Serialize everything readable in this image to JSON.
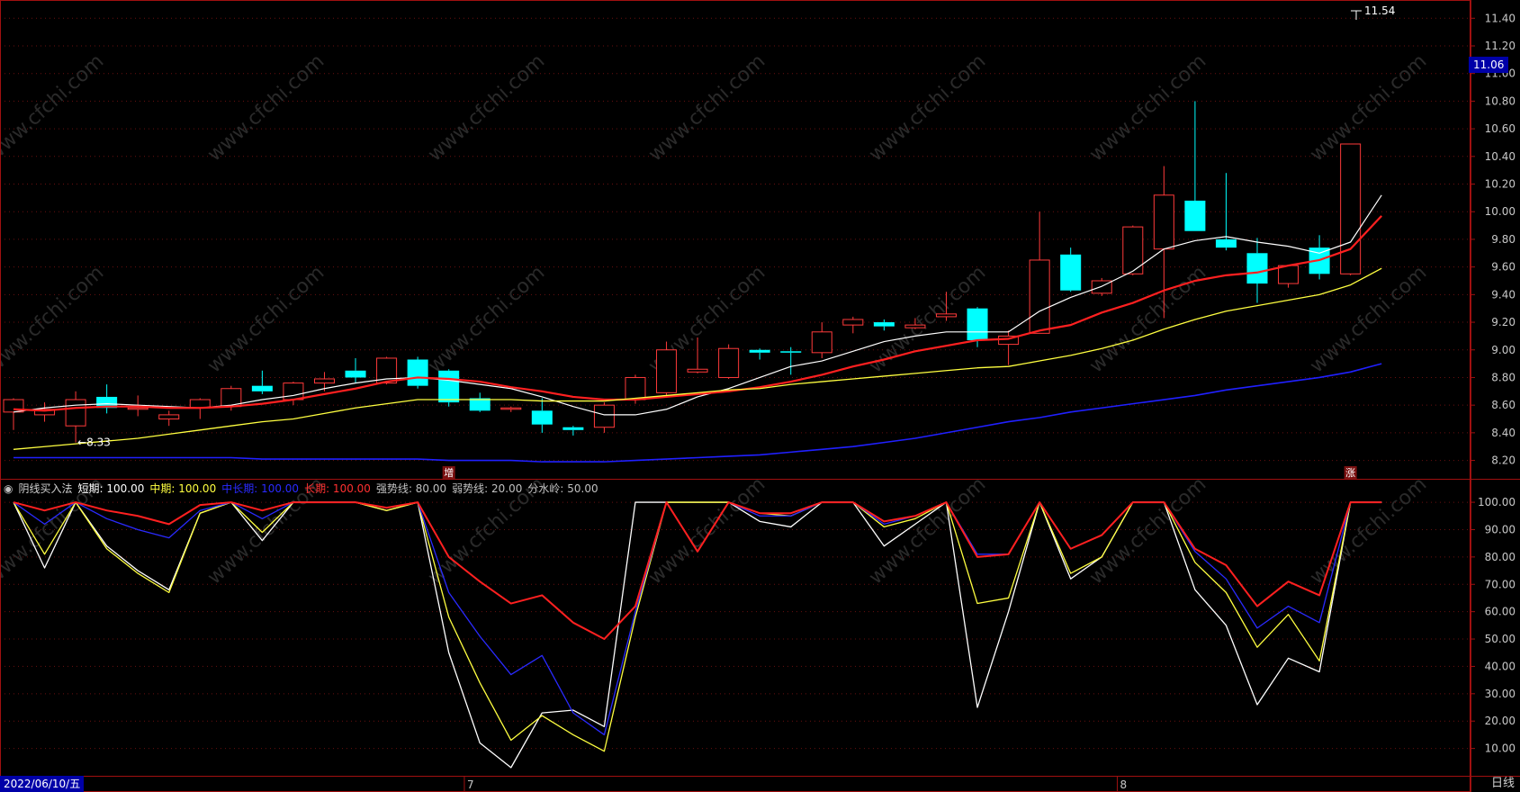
{
  "chart_data": {
    "type": "candlestick",
    "candles": [
      {
        "o": 8.55,
        "h": 8.65,
        "l": 8.42,
        "c": 8.64
      },
      {
        "o": 8.53,
        "h": 8.62,
        "l": 8.48,
        "c": 8.57
      },
      {
        "o": 8.45,
        "h": 8.7,
        "l": 8.33,
        "c": 8.64
      },
      {
        "o": 8.66,
        "h": 8.75,
        "l": 8.54,
        "c": 8.58
      },
      {
        "o": 8.58,
        "h": 8.67,
        "l": 8.52,
        "c": 8.58
      },
      {
        "o": 8.5,
        "h": 8.56,
        "l": 8.45,
        "c": 8.53
      },
      {
        "o": 8.58,
        "h": 8.65,
        "l": 8.5,
        "c": 8.64
      },
      {
        "o": 8.59,
        "h": 8.74,
        "l": 8.56,
        "c": 8.72
      },
      {
        "o": 8.74,
        "h": 8.85,
        "l": 8.68,
        "c": 8.7
      },
      {
        "o": 8.64,
        "h": 8.77,
        "l": 8.6,
        "c": 8.76
      },
      {
        "o": 8.76,
        "h": 8.84,
        "l": 8.7,
        "c": 8.79
      },
      {
        "o": 8.85,
        "h": 8.94,
        "l": 8.76,
        "c": 8.8
      },
      {
        "o": 8.76,
        "h": 8.95,
        "l": 8.75,
        "c": 8.94
      },
      {
        "o": 8.93,
        "h": 8.95,
        "l": 8.72,
        "c": 8.74
      },
      {
        "o": 8.85,
        "h": 8.86,
        "l": 8.59,
        "c": 8.62
      },
      {
        "o": 8.65,
        "h": 8.69,
        "l": 8.55,
        "c": 8.56
      },
      {
        "o": 8.58,
        "h": 8.59,
        "l": 8.55,
        "c": 8.58
      },
      {
        "o": 8.56,
        "h": 8.65,
        "l": 8.4,
        "c": 8.46
      },
      {
        "o": 8.44,
        "h": 8.45,
        "l": 8.38,
        "c": 8.42
      },
      {
        "o": 8.44,
        "h": 8.62,
        "l": 8.4,
        "c": 8.6
      },
      {
        "o": 8.64,
        "h": 8.82,
        "l": 8.61,
        "c": 8.8
      },
      {
        "o": 8.69,
        "h": 9.06,
        "l": 8.66,
        "c": 9.0
      },
      {
        "o": 8.84,
        "h": 9.09,
        "l": 8.83,
        "c": 8.86
      },
      {
        "o": 8.8,
        "h": 9.04,
        "l": 8.79,
        "c": 9.01
      },
      {
        "o": 9.0,
        "h": 9.01,
        "l": 8.93,
        "c": 8.98
      },
      {
        "o": 8.99,
        "h": 9.02,
        "l": 8.82,
        "c": 8.98
      },
      {
        "o": 8.98,
        "h": 9.2,
        "l": 8.94,
        "c": 9.13
      },
      {
        "o": 9.18,
        "h": 9.24,
        "l": 9.12,
        "c": 9.22
      },
      {
        "o": 9.2,
        "h": 9.22,
        "l": 9.14,
        "c": 9.17
      },
      {
        "o": 9.16,
        "h": 9.23,
        "l": 9.15,
        "c": 9.18
      },
      {
        "o": 9.24,
        "h": 9.42,
        "l": 9.21,
        "c": 9.26
      },
      {
        "o": 9.3,
        "h": 9.31,
        "l": 9.02,
        "c": 9.07
      },
      {
        "o": 9.04,
        "h": 9.14,
        "l": 8.89,
        "c": 9.1
      },
      {
        "o": 9.12,
        "h": 10.0,
        "l": 9.12,
        "c": 9.65
      },
      {
        "o": 9.69,
        "h": 9.74,
        "l": 9.42,
        "c": 9.43
      },
      {
        "o": 9.41,
        "h": 9.52,
        "l": 9.39,
        "c": 9.5
      },
      {
        "o": 9.55,
        "h": 9.9,
        "l": 9.54,
        "c": 9.89
      },
      {
        "o": 9.73,
        "h": 10.33,
        "l": 9.23,
        "c": 10.12
      },
      {
        "o": 10.08,
        "h": 10.8,
        "l": 9.86,
        "c": 9.86
      },
      {
        "o": 9.8,
        "h": 10.28,
        "l": 9.72,
        "c": 9.74
      },
      {
        "o": 9.7,
        "h": 9.81,
        "l": 9.34,
        "c": 9.48
      },
      {
        "o": 9.48,
        "h": 9.61,
        "l": 9.45,
        "c": 9.61
      },
      {
        "o": 9.74,
        "h": 9.83,
        "l": 9.51,
        "c": 9.55
      },
      {
        "o": 9.55,
        "h": 10.49,
        "l": 9.54,
        "c": 10.49
      }
    ],
    "ma": [
      {
        "color": "#ffffff",
        "width": 1.2,
        "values": [
          8.55,
          8.58,
          8.6,
          8.61,
          8.6,
          8.59,
          8.58,
          8.6,
          8.64,
          8.67,
          8.72,
          8.76,
          8.79,
          8.8,
          8.78,
          8.75,
          8.72,
          8.66,
          8.59,
          8.53,
          8.53,
          8.57,
          8.66,
          8.72,
          8.8,
          8.88,
          8.92,
          8.99,
          9.06,
          9.1,
          9.13,
          9.13,
          9.13,
          9.28,
          9.38,
          9.46,
          9.57,
          9.73,
          9.79,
          9.82,
          9.78,
          9.75,
          9.7,
          9.78,
          10.12
        ]
      },
      {
        "color": "#ff2020",
        "width": 2.2,
        "values": [
          8.57,
          8.56,
          8.58,
          8.59,
          8.59,
          8.58,
          8.58,
          8.59,
          8.61,
          8.64,
          8.68,
          8.72,
          8.77,
          8.8,
          8.79,
          8.77,
          8.73,
          8.7,
          8.66,
          8.64,
          8.64,
          8.66,
          8.68,
          8.7,
          8.73,
          8.77,
          8.82,
          8.88,
          8.93,
          8.99,
          9.03,
          9.07,
          9.08,
          9.14,
          9.18,
          9.27,
          9.34,
          9.43,
          9.5,
          9.54,
          9.56,
          9.61,
          9.65,
          9.73,
          9.97
        ]
      },
      {
        "color": "#ffff40",
        "width": 1.3,
        "values": [
          8.28,
          8.3,
          8.32,
          8.34,
          8.36,
          8.39,
          8.42,
          8.45,
          8.48,
          8.5,
          8.54,
          8.58,
          8.61,
          8.64,
          8.64,
          8.64,
          8.64,
          8.63,
          8.63,
          8.63,
          8.65,
          8.67,
          8.69,
          8.71,
          8.72,
          8.75,
          8.77,
          8.79,
          8.81,
          8.83,
          8.85,
          8.87,
          8.88,
          8.92,
          8.96,
          9.01,
          9.07,
          9.15,
          9.22,
          9.28,
          9.32,
          9.36,
          9.4,
          9.47,
          9.59
        ]
      },
      {
        "color": "#2020ff",
        "width": 1.6,
        "values": [
          8.22,
          8.22,
          8.22,
          8.22,
          8.22,
          8.22,
          8.22,
          8.22,
          8.21,
          8.21,
          8.21,
          8.21,
          8.21,
          8.21,
          8.2,
          8.2,
          8.2,
          8.19,
          8.19,
          8.19,
          8.2,
          8.21,
          8.22,
          8.23,
          8.24,
          8.26,
          8.28,
          8.3,
          8.33,
          8.36,
          8.4,
          8.44,
          8.48,
          8.51,
          8.55,
          8.58,
          8.61,
          8.64,
          8.67,
          8.71,
          8.74,
          8.77,
          8.8,
          8.84,
          8.9
        ]
      }
    ],
    "price_axis": {
      "min": 8.08,
      "max": 11.48,
      "ticks": [
        "8.20",
        "8.40",
        "8.60",
        "8.80",
        "9.00",
        "9.20",
        "9.40",
        "9.60",
        "9.80",
        "10.00",
        "10.20",
        "10.40",
        "10.60",
        "10.80",
        "11.00",
        "11.20",
        "11.40"
      ]
    },
    "current_price": "11.06",
    "current_price_value": 11.06,
    "high_marker": "11.54",
    "low_marker": "8.33",
    "low_marker_index": 2,
    "low_marker_value": 8.33,
    "signals": [
      {
        "index": 14,
        "text": "增"
      },
      {
        "index": 43,
        "text": "涨"
      }
    ],
    "month_marks": [
      {
        "index": 15,
        "text": "7"
      },
      {
        "index": 36,
        "text": "8"
      }
    ],
    "indicator": {
      "name": "阴线买入法",
      "legend": [
        {
          "text": "短期: 100.00",
          "color": "#ffffff"
        },
        {
          "text": "中期: 100.00",
          "color": "#ffff40"
        },
        {
          "text": "中长期: 100.00",
          "color": "#2a2aff"
        },
        {
          "text": "长期: 100.00",
          "color": "#ff3030"
        },
        {
          "text": "强势线: 80.00",
          "color": "#c0c0c0"
        },
        {
          "text": "弱势线: 20.00",
          "color": "#c0c0c0"
        },
        {
          "text": "分水岭: 50.00",
          "color": "#c0c0c0"
        }
      ],
      "axis": {
        "min": 0,
        "max": 102,
        "ticks": [
          "10.00",
          "20.00",
          "30.00",
          "40.00",
          "50.00",
          "60.00",
          "70.00",
          "80.00",
          "90.00",
          "100.00"
        ]
      },
      "series": [
        {
          "name": "短期",
          "color": "#ffffff",
          "values": [
            100,
            76,
            100,
            84,
            75,
            68,
            96,
            100,
            86,
            100,
            100,
            100,
            97,
            100,
            45,
            12,
            3,
            23,
            24,
            18,
            100,
            100,
            100,
            100,
            93,
            91,
            100,
            100,
            84,
            92,
            100,
            25,
            60,
            100,
            72,
            80,
            100,
            100,
            68,
            55,
            26,
            43,
            38,
            100,
            100
          ]
        },
        {
          "name": "中期",
          "color": "#ffff40",
          "values": [
            100,
            81,
            100,
            83,
            74,
            67,
            96,
            100,
            89,
            100,
            100,
            100,
            97,
            100,
            58,
            34,
            13,
            22,
            15,
            9,
            58,
            100,
            100,
            100,
            96,
            95,
            100,
            100,
            91,
            94,
            100,
            63,
            65,
            100,
            74,
            80,
            100,
            100,
            78,
            67,
            47,
            59,
            42,
            100,
            100
          ]
        },
        {
          "name": "中长期",
          "color": "#2a2aff",
          "values": [
            100,
            92,
            100,
            94,
            90,
            87,
            97,
            100,
            94,
            100,
            100,
            100,
            98,
            100,
            67,
            51,
            37,
            44,
            23,
            15,
            60,
            100,
            82,
            100,
            95,
            95,
            100,
            100,
            92,
            95,
            100,
            81,
            81,
            100,
            83,
            88,
            100,
            100,
            82,
            72,
            54,
            62,
            56,
            100,
            100
          ]
        },
        {
          "name": "长期",
          "color": "#ff2020",
          "values": [
            100,
            97,
            100,
            97,
            95,
            92,
            99,
            100,
            97,
            100,
            100,
            100,
            98,
            100,
            80,
            71,
            63,
            66,
            56,
            50,
            62,
            100,
            82,
            100,
            96,
            96,
            100,
            100,
            93,
            95,
            100,
            80,
            81,
            100,
            83,
            88,
            100,
            100,
            83,
            77,
            62,
            71,
            66,
            100,
            100
          ]
        }
      ]
    }
  },
  "footer": {
    "date": "2022/06/10/五",
    "period": "日线"
  },
  "watermark": "www.cfchi.com"
}
